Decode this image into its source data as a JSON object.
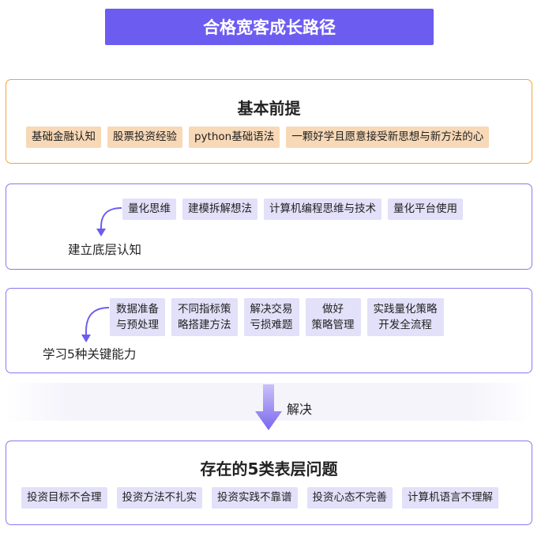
{
  "header": {
    "title": "合格宽客成长路径"
  },
  "basics": {
    "title": "基本前提",
    "items": [
      "基础金融认知",
      "股票投资经验",
      "python基础语法",
      "一颗好学且愿意接受新思想与新方法的心"
    ]
  },
  "cognition": {
    "label": "建立底层认知",
    "items": [
      "量化思维",
      "建模拆解想法",
      "计算机编程思维与技术",
      "量化平台使用"
    ]
  },
  "abilities": {
    "label": "学习5种关键能力",
    "items": [
      "数据准备\n与预处理",
      "不同指标策\n略搭建方法",
      "解决交易\n亏损难题",
      "做好\n策略管理",
      "实践量化策略\n开发全流程"
    ]
  },
  "transition": {
    "label": "解决"
  },
  "problems": {
    "title": "存在的5类表层问题",
    "items": [
      "投资目标不合理",
      "投资方法不扎实",
      "投资实践不靠谱",
      "投资心态不完善",
      "计算机语言不理解"
    ]
  },
  "colors": {
    "accent": "#6c5cf0",
    "orange_border": "#f2a43c",
    "orange_chip": "#f7d8b7",
    "purple_chip": "#e3e0f9"
  }
}
